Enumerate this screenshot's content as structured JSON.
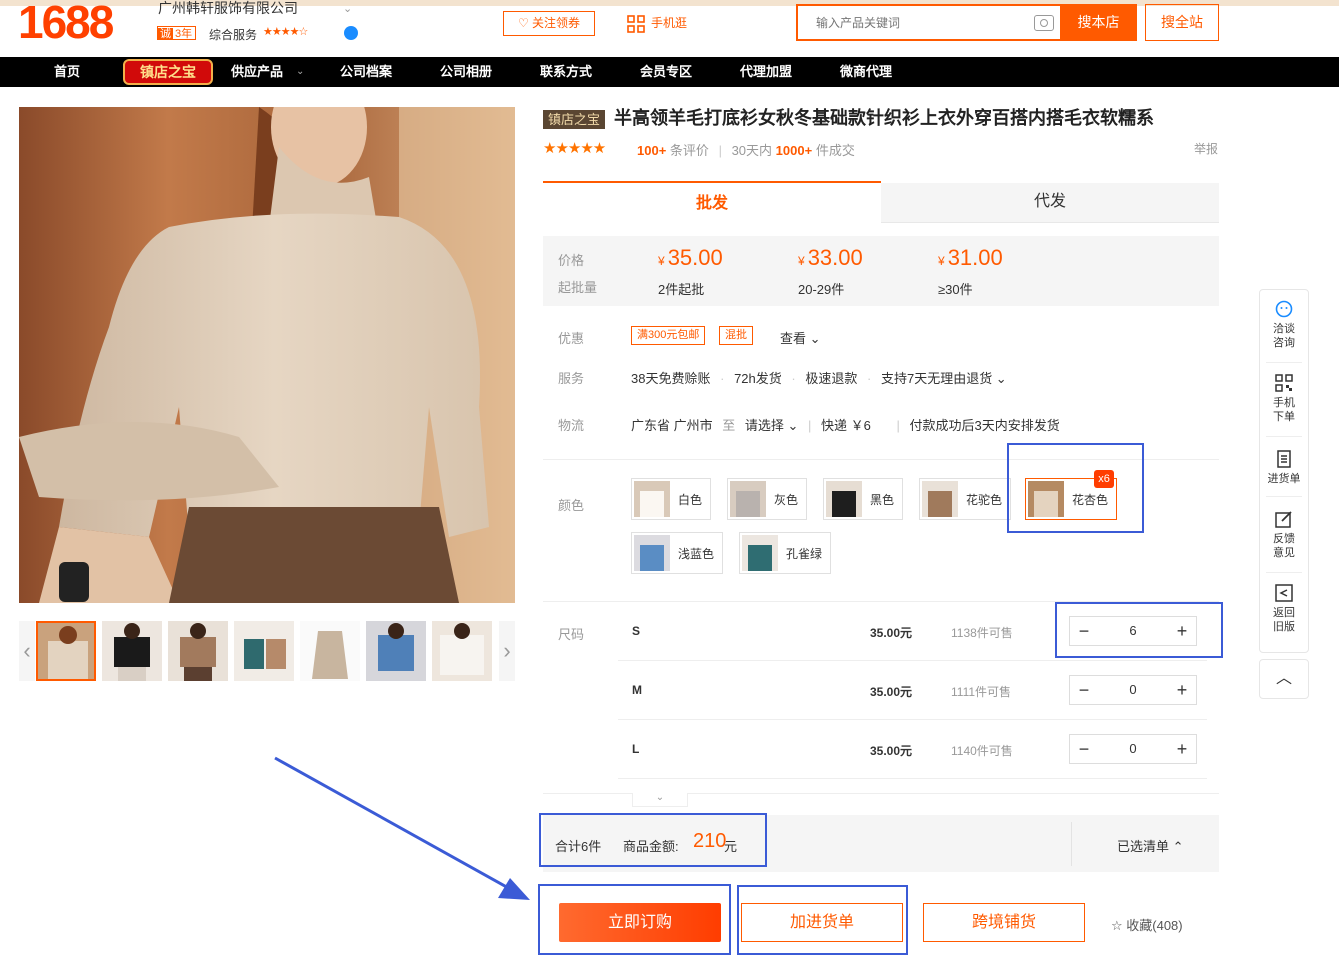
{
  "header": {
    "logo": "1688",
    "company_name": "广州韩轩服饰有限公司",
    "cheng_badge": "诚",
    "cheng_years": "3年",
    "service_label": "综合服务",
    "service_stars": "★★★★☆",
    "follow_button": "♡ 关注领券",
    "mobile_link": "手机逛",
    "search_placeholder": "输入产品关键词",
    "search_store_button": "搜本店",
    "search_all_button": "搜全站"
  },
  "nav": {
    "items": [
      "首页",
      "镇店之宝",
      "供应产品",
      "公司档案",
      "公司相册",
      "联系方式",
      "会员专区",
      "代理加盟",
      "微商代理"
    ]
  },
  "product": {
    "tag": "镇店之宝",
    "title": "半高领羊毛打底衫女秋冬基础款针织衫上衣外穿百搭内搭毛衣软糯系",
    "rating_stars": "★★★★★",
    "reviews_count": "100+",
    "reviews_label": "条评价",
    "sales_prefix": "30天内",
    "sales_count": "1000+",
    "sales_suffix": "件成交",
    "report": "举报"
  },
  "tabs": {
    "wholesale": "批发",
    "dropship": "代发"
  },
  "pricing": {
    "price_label": "价格",
    "moq_label": "起批量",
    "currency": "¥",
    "tiers": [
      {
        "price": "35.00",
        "qty": "2件起批"
      },
      {
        "price": "33.00",
        "qty": "20-29件"
      },
      {
        "price": "31.00",
        "qty": "≥30件"
      }
    ]
  },
  "promo": {
    "label": "优惠",
    "tag1": "满300元包邮",
    "tag2": "混批",
    "view": "查看 ⌄"
  },
  "service": {
    "label": "服务",
    "items": [
      "38天免费赊账",
      "72h发货",
      "极速退款",
      "支持7天无理由退货 ⌄"
    ]
  },
  "logistics": {
    "label": "物流",
    "from": "广东省 广州市",
    "to_word": "至",
    "to_select": "请选择 ⌄",
    "express": "快递 ￥6",
    "ship_note": "付款成功后3天内安排发货"
  },
  "colors": {
    "label": "颜色",
    "options": [
      "白色",
      "灰色",
      "黑色",
      "花驼色",
      "花杏色",
      "浅蓝色",
      "孔雀绿"
    ],
    "selected": "花杏色",
    "selected_badge": "x6"
  },
  "sizes": {
    "label": "尺码",
    "rows": [
      {
        "name": "S",
        "price": "35.00元",
        "stock": "1138件可售",
        "qty": "6"
      },
      {
        "name": "M",
        "price": "35.00元",
        "stock": "1111件可售",
        "qty": "0"
      },
      {
        "name": "L",
        "price": "35.00元",
        "stock": "1140件可售",
        "qty": "0"
      }
    ],
    "minus": "−",
    "plus": "+"
  },
  "summary": {
    "count": "合计6件",
    "amount_label": "商品金额:",
    "amount": "210",
    "unit": "元",
    "selected_list": "已选清单 ⌃"
  },
  "actions": {
    "buy_now": "立即订购",
    "add_to_cart": "加进货单",
    "cross_border": "跨境铺货",
    "favorite": "☆ 收藏(408)"
  },
  "right_sidebar": {
    "items": [
      "洽谈咨询",
      "手机下单",
      "进货单",
      "反馈意见",
      "返回旧版"
    ],
    "top_arrow": "︿"
  },
  "colors_theme": {
    "accent": "#ff5a00",
    "annotation": "#3b5bd6",
    "nav_bg": "#000000"
  }
}
